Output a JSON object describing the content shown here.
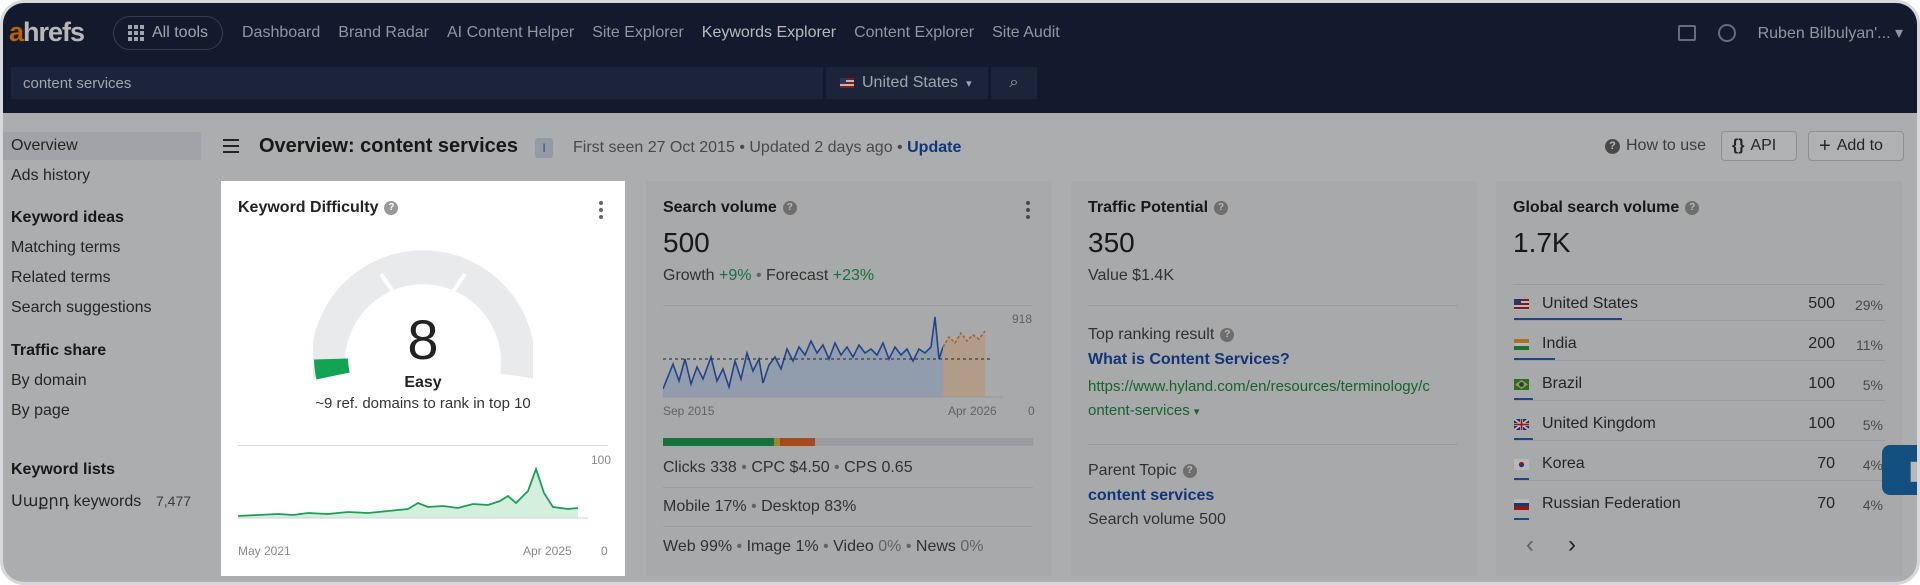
{
  "nav": {
    "logo_a": "a",
    "logo_rest": "hrefs",
    "all_tools": "All tools",
    "links": [
      "Dashboard",
      "Brand Radar",
      "AI Content Helper",
      "Site Explorer",
      "Keywords Explorer",
      "Content Explorer",
      "Site Audit"
    ],
    "active_index": 4,
    "user": "Ruben Bilbulyan'...",
    "user_chevron": "▾"
  },
  "search": {
    "query": "content services",
    "country": "United States",
    "country_chevron": "▾",
    "search_icon": "⌕"
  },
  "sidebar": {
    "overview": "Overview",
    "ads_history": "Ads history",
    "keyword_ideas": "Keyword ideas",
    "matching_terms": "Matching terms",
    "related_terms": "Related terms",
    "search_suggestions": "Search suggestions",
    "traffic_share": "Traffic share",
    "by_domain": "By domain",
    "by_page": "By page",
    "keyword_lists": "Keyword lists",
    "list_name": "Սաքրդ keywords",
    "list_count": "7,477"
  },
  "header": {
    "title": "Overview: content services",
    "badge": "I",
    "first_seen": "First seen 27 Oct 2015",
    "updated": "Updated 2 days ago",
    "update_link": "Update",
    "sep": "•",
    "how_to_use": "How to use",
    "help_glyph": "?",
    "api": "API",
    "api_icon": "{}",
    "add_to": "Add to",
    "add_icon": "+"
  },
  "kd": {
    "title": "Keyword Difficulty",
    "value": "8",
    "value_fraction": 0.08,
    "label": "Easy",
    "desc": "~9 ref. domains to rank in top 10",
    "chart_max": "100",
    "chart_min": "0",
    "x_start": "May 2021",
    "x_end": "Apr 2025"
  },
  "sv": {
    "title": "Search volume",
    "value": "500",
    "growth_label": "Growth",
    "growth": "+9%",
    "forecast_label": "Forecast",
    "forecast": "+23%",
    "chart_max": "918",
    "chart_min": "0",
    "x_start": "Sep 2015",
    "x_end": "Apr 2026",
    "clicks": "Clicks 338",
    "cpc": "CPC $4.50",
    "cps": "CPS 0.65",
    "mobile": "Mobile 17%",
    "desktop": "Desktop 83%",
    "web": "Web 99%",
    "image": "Image 1%",
    "video_label": "Video",
    "video": "0%",
    "news_label": "News",
    "news": "0%",
    "sep": "•"
  },
  "tp": {
    "title": "Traffic Potential",
    "value": "350",
    "value_line": "Value $1.4K",
    "top_result_label": "Top ranking result",
    "top_result_title": "What is Content Services?",
    "top_result_url_1": "https://www.hyland.com/en/resources/terminology/c",
    "top_result_url_2": "ontent-services",
    "url_chevron": "▾",
    "parent_label": "Parent Topic",
    "parent_topic": "content services",
    "parent_volume": "Search volume 500"
  },
  "gsv": {
    "title": "Global search volume",
    "value": "1.7K",
    "countries": [
      {
        "name": "United States",
        "volume": "500",
        "pct": "29%",
        "share": 0.29
      },
      {
        "name": "India",
        "volume": "200",
        "pct": "11%",
        "share": 0.11
      },
      {
        "name": "Brazil",
        "volume": "100",
        "pct": "5%",
        "share": 0.05
      },
      {
        "name": "United Kingdom",
        "volume": "100",
        "pct": "5%",
        "share": 0.05
      },
      {
        "name": "Korea",
        "volume": "70",
        "pct": "4%",
        "share": 0.04
      },
      {
        "name": "Russian Federation",
        "volume": "70",
        "pct": "4%",
        "share": 0.04
      }
    ],
    "prev": "‹",
    "next": "›"
  },
  "chat": {
    "icon": "❚"
  }
}
